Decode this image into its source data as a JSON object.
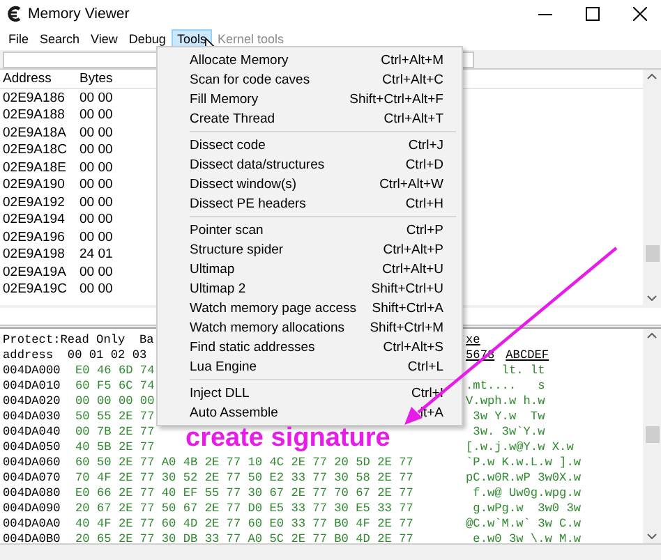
{
  "window": {
    "title": "Memory Viewer"
  },
  "menubar": [
    {
      "label": "File",
      "selected": false,
      "disabled": false
    },
    {
      "label": "Search",
      "selected": false,
      "disabled": false
    },
    {
      "label": "View",
      "selected": false,
      "disabled": false
    },
    {
      "label": "Debug",
      "selected": false,
      "disabled": false
    },
    {
      "label": "Tools",
      "selected": true,
      "disabled": false
    },
    {
      "label": "Kernel tools",
      "selected": false,
      "disabled": true
    }
  ],
  "disassembly": {
    "columns": [
      "Address",
      "Bytes"
    ],
    "rows": [
      [
        "02E9A186",
        "00 00"
      ],
      [
        "02E9A188",
        "00 00"
      ],
      [
        "02E9A18A",
        "00 00"
      ],
      [
        "02E9A18C",
        "00 00"
      ],
      [
        "02E9A18E",
        "00 00"
      ],
      [
        "02E9A190",
        "00 00"
      ],
      [
        "02E9A192",
        "00 00"
      ],
      [
        "02E9A194",
        "00 00"
      ],
      [
        "02E9A196",
        "00 00"
      ],
      [
        "02E9A198",
        "24 01"
      ],
      [
        "02E9A19A",
        "00 00"
      ],
      [
        "02E9A19C",
        "00 00"
      ]
    ]
  },
  "hex_view": {
    "header": [
      [
        "Protect:Read Only  Ba",
        "xe"
      ],
      [
        "address  00 01 02 03",
        "5678",
        "ABCDEF"
      ]
    ],
    "rows": [
      {
        "address": "004DA000",
        "bytes": "E0 46 6D 74",
        "ascii": "     lt. lt"
      },
      {
        "address": "004DA010",
        "bytes": "60 F5 6C 74",
        "ascii": ".mt....   s"
      },
      {
        "address": "004DA020",
        "bytes": "00 00 00 00",
        "ascii": "V.wph.w h.w"
      },
      {
        "address": "004DA030",
        "bytes": "50 55 2E 77",
        "ascii": " 3w Y.w  Tw"
      },
      {
        "address": "004DA040",
        "bytes": "00 7B 2E 77",
        "ascii": " 3w. 3w`Y.w"
      },
      {
        "address": "004DA050",
        "bytes": "40 5B 2E 77",
        "ascii": "[.w.j.w@Y.w X.w"
      },
      {
        "address": "004DA060",
        "bytes": "60 50 2E 77 A0 4B 2E 77 10 4C 2E 77 20 5D 2E 77",
        "ascii": "`P.w K.w.L.w ].w"
      },
      {
        "address": "004DA070",
        "bytes": "70 4F 2E 77 30 52 2E 77 50 E2 33 77 30 58 2E 77",
        "ascii": "pC.w0R.wP 3w0X.w"
      },
      {
        "address": "004DA080",
        "bytes": "E0 66 2E 77 40 EF 55 77 30 67 2E 77 70 67 2E 77",
        "ascii": " f.w@ Uw0g.wpg.w"
      },
      {
        "address": "004DA090",
        "bytes": "20 67 2E 77 50 67 2E 77 D0 E5 33 77 30 E5 33 77",
        "ascii": " g.wPg.w  3w0 3w"
      },
      {
        "address": "004DA0A0",
        "bytes": "40 4F 2E 77 60 4D 2E 77 60 E0 33 77 B0 4F 2E 77",
        "ascii": "@C.w`M.w` 3w C.w"
      },
      {
        "address": "004DA0B0",
        "bytes": "20 65 2E 77 30 DB 33 77 A0 5C 2E 77 B0 4D 2E 77",
        "ascii": " e.w0 3w \\.w M.w"
      }
    ]
  },
  "tools_menu": {
    "groups": [
      [
        {
          "label": "Allocate Memory",
          "shortcut": "Ctrl+Alt+M"
        },
        {
          "label": "Scan for code caves",
          "shortcut": "Ctrl+Alt+C"
        },
        {
          "label": "Fill Memory",
          "shortcut": "Shift+Ctrl+Alt+F"
        },
        {
          "label": "Create Thread",
          "shortcut": "Ctrl+Alt+T"
        }
      ],
      [
        {
          "label": "Dissect code",
          "shortcut": "Ctrl+J"
        },
        {
          "label": "Dissect data/structures",
          "shortcut": "Ctrl+D"
        },
        {
          "label": "Dissect window(s)",
          "shortcut": "Ctrl+Alt+W"
        },
        {
          "label": "Dissect PE headers",
          "shortcut": "Ctrl+H"
        }
      ],
      [
        {
          "label": "Pointer scan",
          "shortcut": "Ctrl+P"
        },
        {
          "label": "Structure spider",
          "shortcut": "Ctrl+Alt+P"
        },
        {
          "label": "Ultimap",
          "shortcut": "Ctrl+Alt+U"
        },
        {
          "label": "Ultimap 2",
          "shortcut": "Shift+Ctrl+U"
        },
        {
          "label": "Watch memory page access",
          "shortcut": "Shift+Ctrl+A"
        },
        {
          "label": "Watch memory allocations",
          "shortcut": "Shift+Ctrl+M"
        },
        {
          "label": "Find static addresses",
          "shortcut": "Ctrl+Alt+S"
        },
        {
          "label": "Lua Engine",
          "shortcut": "Ctrl+L"
        }
      ],
      [
        {
          "label": "Inject DLL",
          "shortcut": "Ctrl+I"
        },
        {
          "label": "Auto Assemble",
          "shortcut": "lt+A"
        }
      ]
    ]
  },
  "annotation": {
    "text": "create signature"
  }
}
